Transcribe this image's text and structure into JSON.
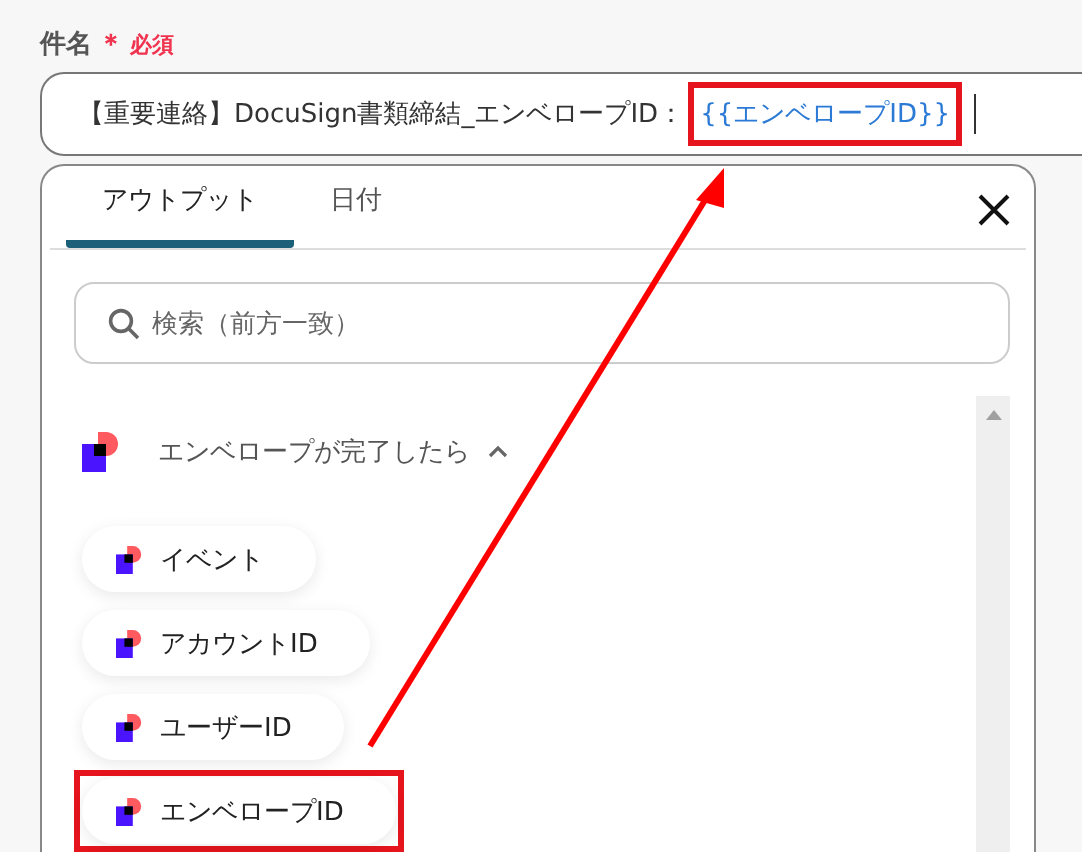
{
  "field": {
    "label": "件名",
    "required_mark": "＊",
    "required_text": "必須",
    "value": "【重要連絡】DocuSign書類締結_エンベロープID：",
    "token": "{{エンベロープID}}",
    "token_highlighted": true
  },
  "panel": {
    "tabs": [
      {
        "label": "アウトプット",
        "selected": true
      },
      {
        "label": "日付",
        "selected": false
      }
    ],
    "search": {
      "placeholder": "検索（前方一致）"
    },
    "group": {
      "title": "エンベロープが完了したら",
      "expanded": true,
      "items": [
        {
          "label": "イベント",
          "highlighted": false
        },
        {
          "label": "アカウントID",
          "highlighted": false
        },
        {
          "label": "ユーザーID",
          "highlighted": false
        },
        {
          "label": "エンベロープID",
          "highlighted": true
        }
      ]
    }
  }
}
